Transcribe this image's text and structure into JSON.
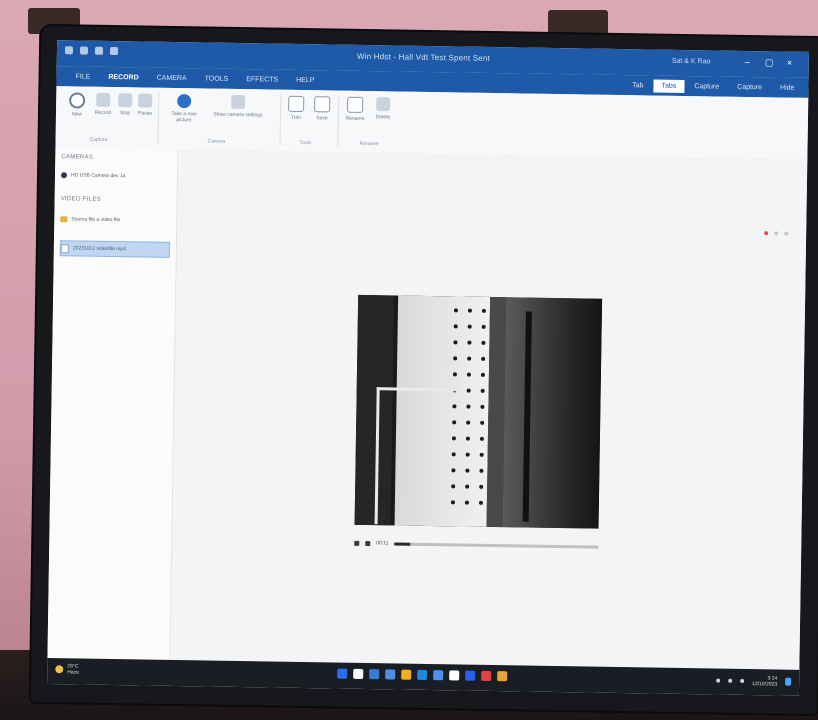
{
  "titlebar": {
    "title": "Win Hdst - Hall Vdt Test Spent Sent",
    "user": "Sat & K Rao",
    "minimize": "–",
    "maximize": "▢",
    "close": "×"
  },
  "ribbon": {
    "tabs": [
      "File",
      "Record",
      "Camera",
      "Tools",
      "Effects",
      "Help"
    ],
    "active_tab": "Record",
    "right_tabs": [
      "Tab",
      "Tabs",
      "Capture",
      "Capture",
      "Hide"
    ],
    "groups": [
      {
        "label": "Capture",
        "buttons": [
          "New",
          "Record",
          "Stop",
          "Pause"
        ]
      },
      {
        "label": "Camera",
        "buttons": [
          "Take a new picture",
          "Show camera settings"
        ]
      },
      {
        "label": "Tools",
        "buttons": [
          "Trim",
          "Save"
        ]
      },
      {
        "label": "Rename",
        "buttons": [
          "Rename",
          "Delete"
        ]
      }
    ]
  },
  "sidebar": {
    "section1": "Cameras",
    "camera_item": "HD USB Camera dev 1a",
    "section2": "Video Files",
    "folder_item": "Source file a video file",
    "selected_item": "20231012 videofile.mp4"
  },
  "player": {
    "time": "00:11",
    "progress": 0.08
  },
  "taskbar": {
    "weather_temp": "28°C",
    "weather_desc": "Haze",
    "clock_time": "3:14",
    "clock_date": "12/10/2023",
    "pinned_colors": [
      "#2c6cf0",
      "#ffffff",
      "#3a7bd5",
      "#4a90e2",
      "#f2b01e",
      "#1e8ad6",
      "#4c8df6",
      "#ffffff",
      "#2563eb",
      "#e04343",
      "#e7a33a"
    ]
  }
}
